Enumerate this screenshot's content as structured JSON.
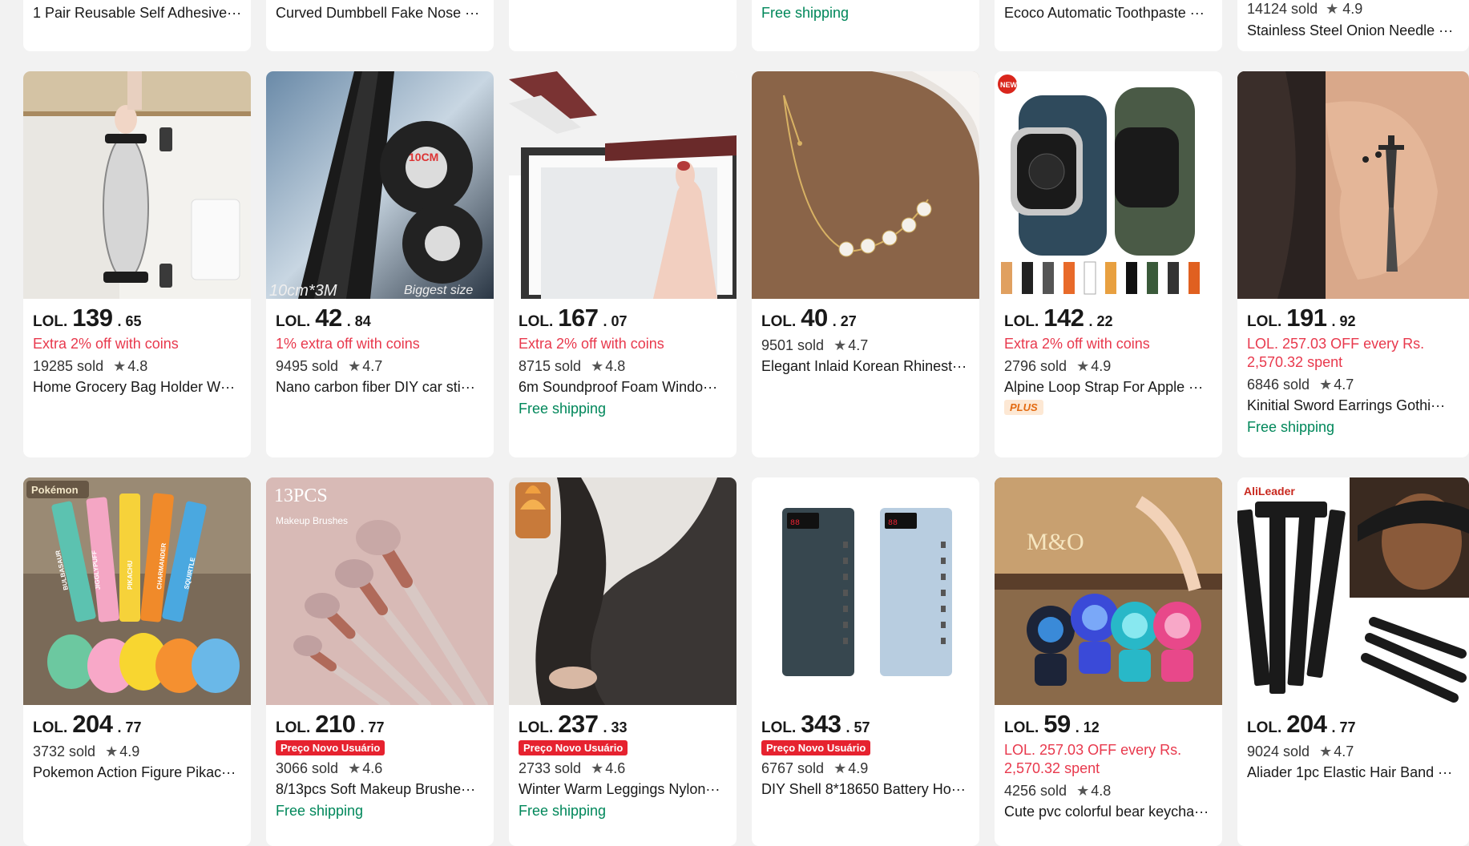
{
  "top_row": [
    {
      "title": "1 Pair Reusable Self Adhesive···"
    },
    {
      "title": "Curved Dumbbell Fake Nose ···"
    },
    {
      "title": ""
    },
    {
      "shipping": "Free shipping"
    },
    {
      "title": "Ecoco Automatic Toothpaste ···"
    },
    {
      "sold": "14124 sold",
      "rating": "4.9",
      "title": "Stainless Steel Onion Needle ···"
    }
  ],
  "products": [
    {
      "currency": "LOL.",
      "int": "139",
      "dec": ". 65",
      "promo": "Extra 2% off with coins",
      "sold": "19285 sold",
      "rating": "4.8",
      "title": "Home Grocery Bag Holder W···"
    },
    {
      "currency": "LOL.",
      "int": "42",
      "dec": ". 84",
      "promo": "1% extra off with coins",
      "sold": "9495 sold",
      "rating": "4.7",
      "title": "Nano carbon fiber DIY car sti···",
      "img_text_a": "10CM",
      "img_text_b": "10cm*3M",
      "img_text_c": "Biggest size"
    },
    {
      "currency": "LOL.",
      "int": "167",
      "dec": ". 07",
      "promo": "Extra 2% off with coins",
      "sold": "8715 sold",
      "rating": "4.8",
      "title": "6m Soundproof Foam Windo···",
      "shipping": "Free shipping"
    },
    {
      "currency": "LOL.",
      "int": "40",
      "dec": ". 27",
      "sold": "9501 sold",
      "rating": "4.7",
      "title": "Elegant Inlaid Korean Rhinest···"
    },
    {
      "currency": "LOL.",
      "int": "142",
      "dec": ". 22",
      "promo": "Extra 2% off with coins",
      "sold": "2796 sold",
      "rating": "4.9",
      "title": "Alpine Loop Strap For Apple ···",
      "plus_badge": "PLUS",
      "img_badge": "NEW"
    },
    {
      "currency": "LOL.",
      "int": "191",
      "dec": ". 92",
      "promo": "LOL. 257.03 OFF every Rs. 2,570.32 spent",
      "sold": "6846 sold",
      "rating": "4.7",
      "title": "Kinitial Sword Earrings Gothi···",
      "shipping": "Free shipping"
    },
    {
      "currency": "LOL.",
      "int": "204",
      "dec": ". 77",
      "sold": "3732 sold",
      "rating": "4.9",
      "title": "Pokemon Action Figure Pikac···",
      "img_text_a": "Pokémon",
      "strap_labels": [
        "BULBASAUR",
        "JIGGLYPUFF",
        "PIKACHU",
        "CHARMANDER",
        "SQUIRTLE"
      ]
    },
    {
      "currency": "LOL.",
      "int": "210",
      "dec": ". 77",
      "badge": "Preço Novo Usuário",
      "sold": "3066 sold",
      "rating": "4.6",
      "title": "8/13pcs Soft Makeup Brushe···",
      "shipping": "Free shipping",
      "img_text_a": "13PCS",
      "img_text_b": "Makeup Brushes"
    },
    {
      "currency": "LOL.",
      "int": "237",
      "dec": ". 33",
      "badge": "Preço Novo Usuário",
      "sold": "2733 sold",
      "rating": "4.6",
      "title": "Winter Warm Leggings Nylon···",
      "shipping": "Free shipping"
    },
    {
      "currency": "LOL.",
      "int": "343",
      "dec": ". 57",
      "badge": "Preço Novo Usuário",
      "sold": "6767 sold",
      "rating": "4.9",
      "title": "DIY Shell 8*18650 Battery Ho···"
    },
    {
      "currency": "LOL.",
      "int": "59",
      "dec": ". 12",
      "promo": "LOL. 257.03 OFF every Rs. 2,570.32 spent",
      "sold": "4256 sold",
      "rating": "4.8",
      "title": "Cute pvc colorful bear keycha···",
      "img_text_a": "M&O"
    },
    {
      "currency": "LOL.",
      "int": "204",
      "dec": ". 77",
      "sold": "9024 sold",
      "rating": "4.7",
      "title": "Aliader 1pc Elastic Hair Band ···",
      "img_text_a": "AliLeader"
    }
  ]
}
